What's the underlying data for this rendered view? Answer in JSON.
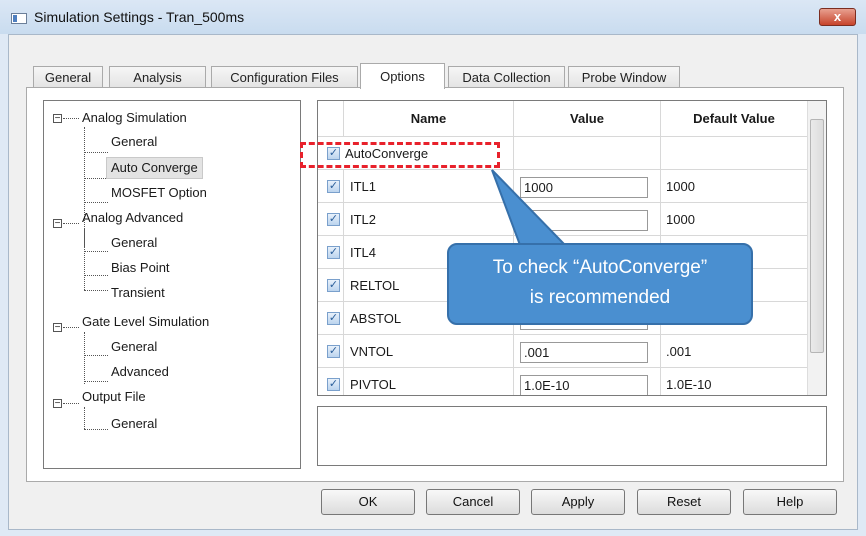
{
  "window": {
    "title": "Simulation Settings - Tran_500ms",
    "close_glyph": "x"
  },
  "tabs": [
    {
      "label": "General"
    },
    {
      "label": "Analysis"
    },
    {
      "label": "Configuration Files"
    },
    {
      "label": "Options"
    },
    {
      "label": "Data Collection"
    },
    {
      "label": "Probe Window"
    }
  ],
  "active_tab": "Options",
  "tree": {
    "expander_glyph": "−",
    "groups": [
      {
        "label": "Analog Simulation",
        "children": [
          "General",
          "Auto Converge",
          "MOSFET Option"
        ]
      },
      {
        "label": "Analog Advanced",
        "children": [
          "General",
          "Bias Point",
          "Transient"
        ]
      },
      {
        "label": "Gate Level Simulation",
        "children": [
          "General",
          "Advanced"
        ]
      },
      {
        "label": "Output File",
        "children": [
          "General"
        ]
      }
    ],
    "selected": "Auto Converge"
  },
  "grid": {
    "columns": [
      "Name",
      "Value",
      "Default Value"
    ],
    "check_glyph": "✓",
    "rows": [
      {
        "name": "AutoConverge",
        "value": "",
        "default": ""
      },
      {
        "name": "ITL1",
        "value": "1000",
        "default": "1000"
      },
      {
        "name": "ITL2",
        "value": "",
        "default": "1000"
      },
      {
        "name": "ITL4",
        "value": "",
        "default": ""
      },
      {
        "name": "RELTOL",
        "value": "",
        "default": ""
      },
      {
        "name": "ABSTOL",
        "value": "",
        "default": ""
      },
      {
        "name": "VNTOL",
        "value": ".001",
        "default": ".001"
      },
      {
        "name": "PIVTOL",
        "value": "1.0E-10",
        "default": "1.0E-10"
      }
    ]
  },
  "buttons": {
    "ok": "OK",
    "cancel": "Cancel",
    "apply": "Apply",
    "reset": "Reset",
    "help": "Help"
  },
  "callout": {
    "line1": "To check “AutoConverge”",
    "line2": "is recommended"
  },
  "colors": {
    "highlight": "#e8212b",
    "callout": "#4a8fd0",
    "titlebar": "#c9dcef"
  }
}
